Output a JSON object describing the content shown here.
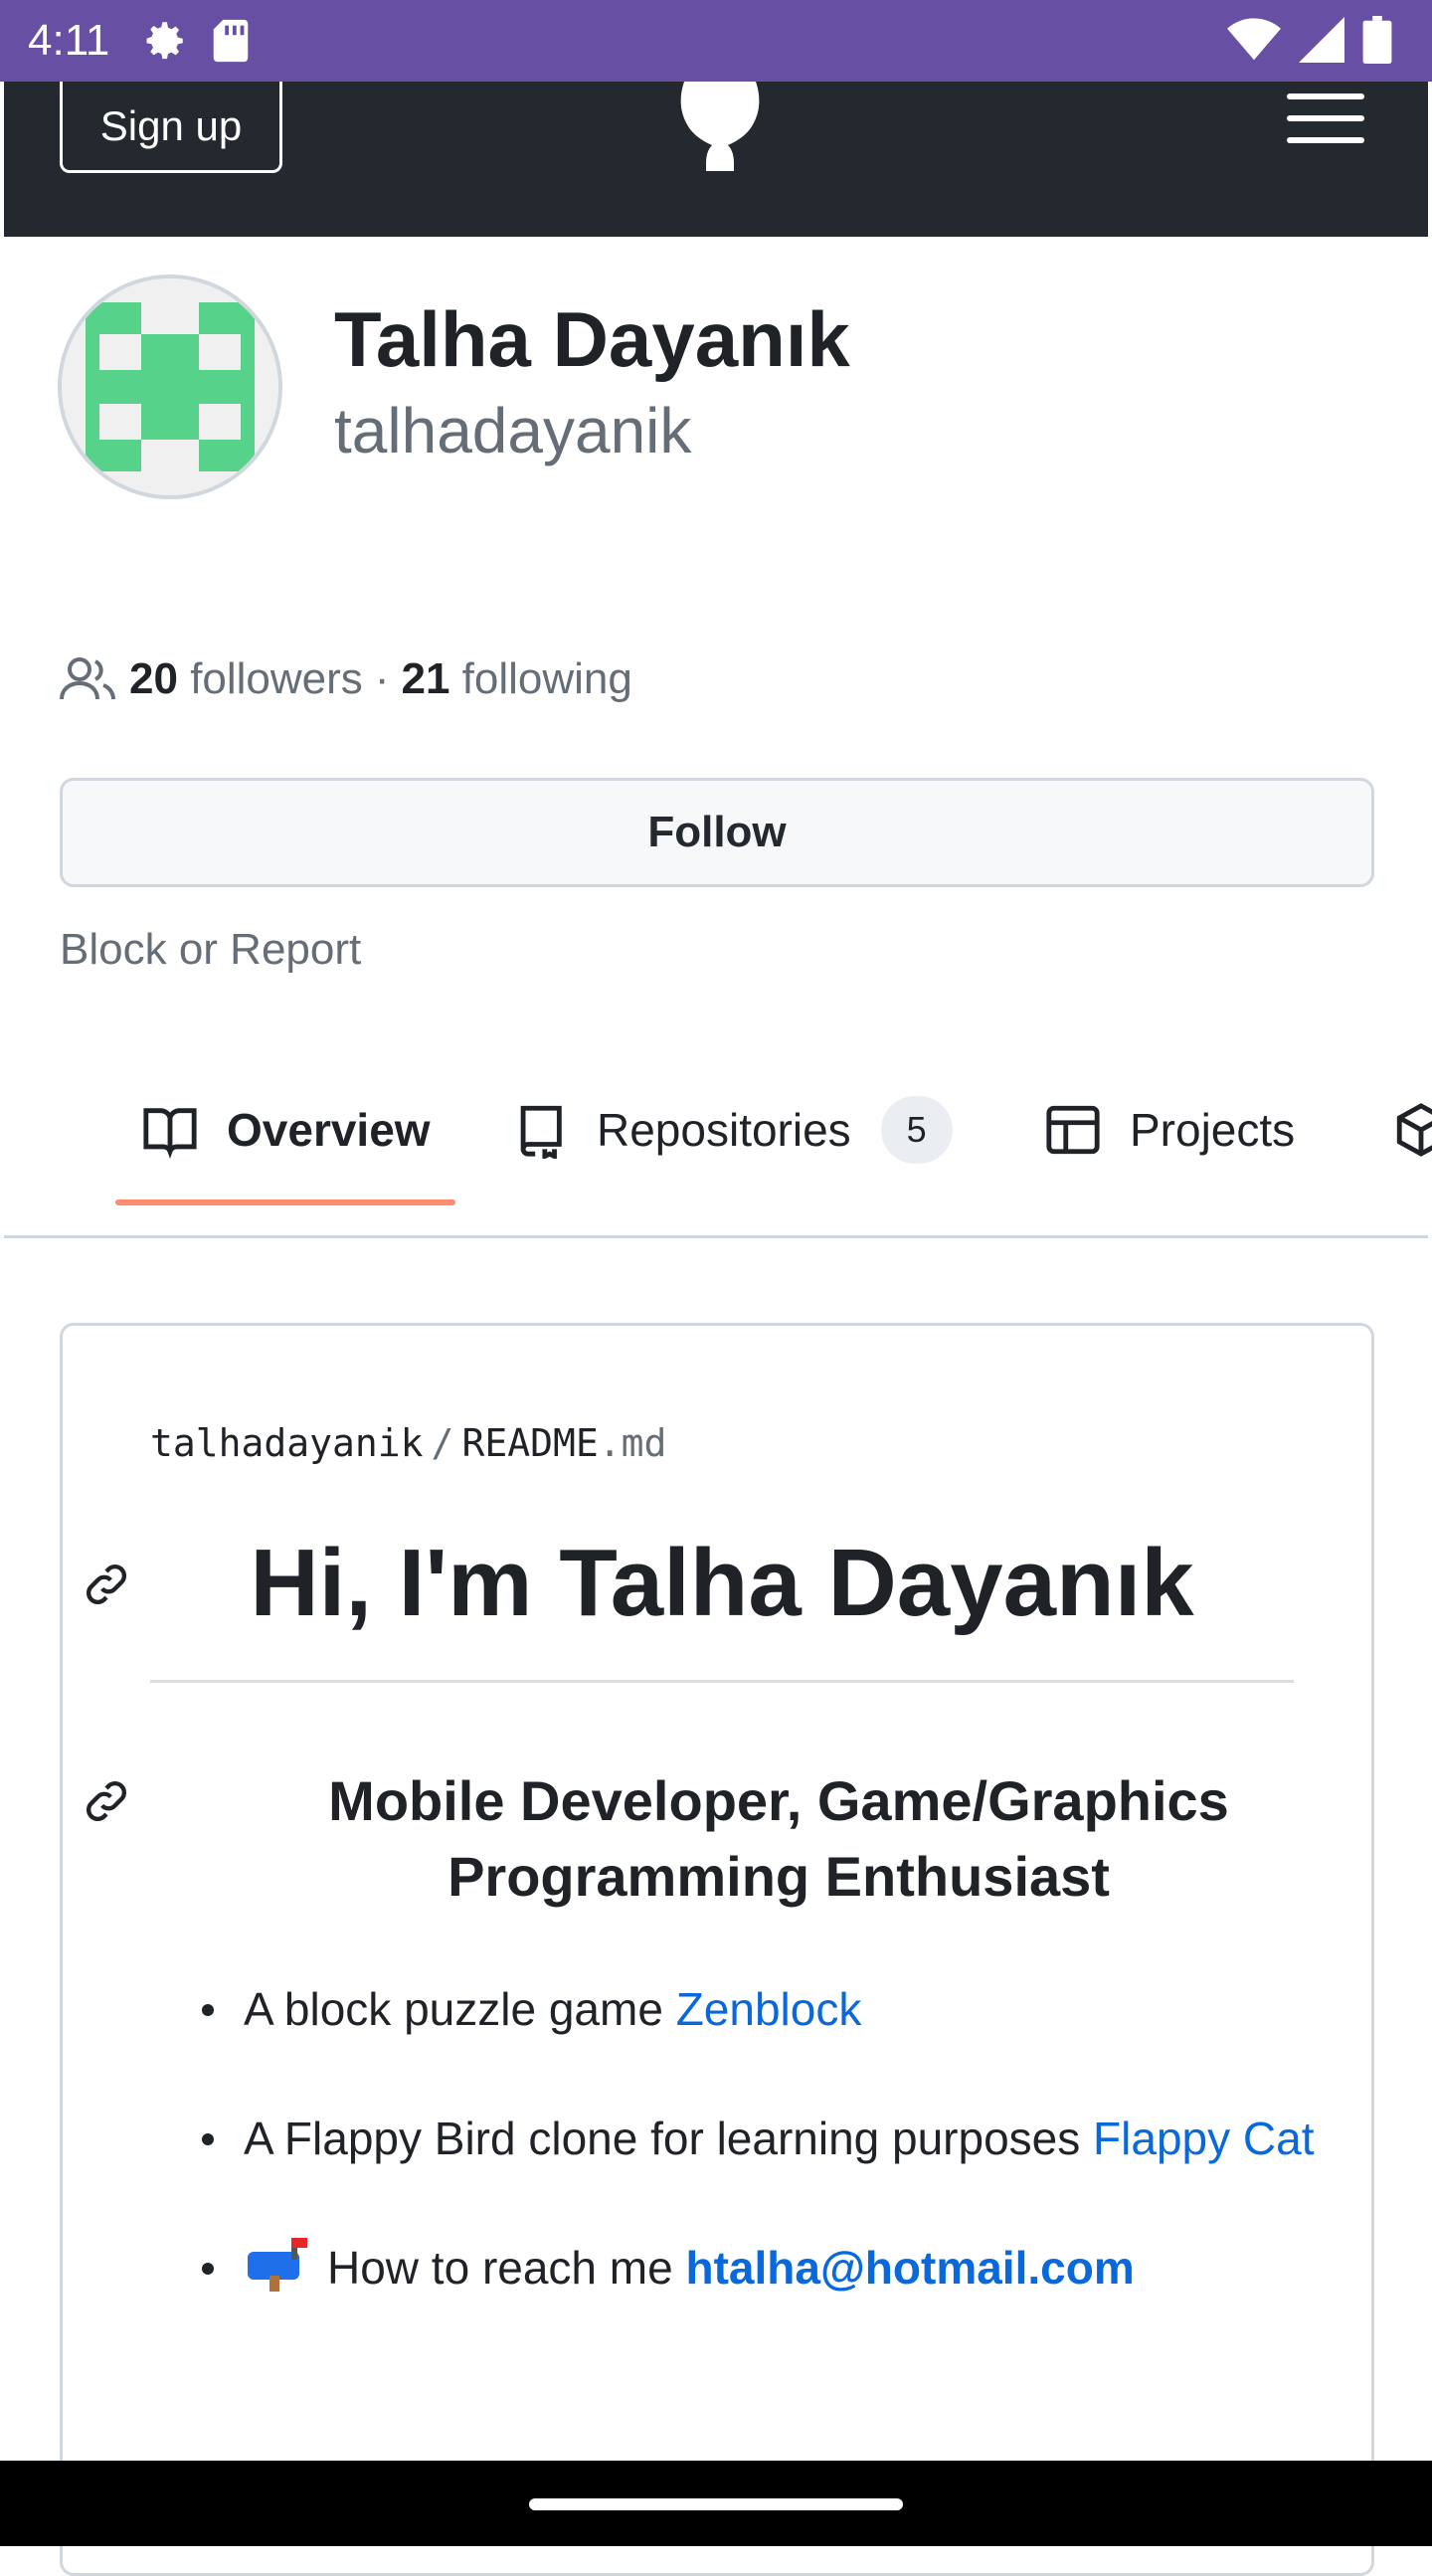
{
  "status_bar": {
    "time": "4:11"
  },
  "header": {
    "signup_label": "Sign up"
  },
  "profile": {
    "name": "Talha Dayanık",
    "login": "talhadayanik",
    "followers_count": "20",
    "followers_label": "followers",
    "separator": "·",
    "following_count": "21",
    "following_label": "following",
    "follow_label": "Follow",
    "block_report_label": "Block or Report"
  },
  "tabs": {
    "overview": "Overview",
    "repositories": "Repositories",
    "repositories_count": "5",
    "projects": "Projects"
  },
  "readme": {
    "path_owner": "talhadayanik",
    "path_sep": "/",
    "path_file": "README",
    "path_ext": ".md",
    "h1": "Hi, I'm Talha Dayanık",
    "h2": "Mobile Developer, Game/Graphics Programming Enthusiast",
    "items": [
      {
        "text": "A block puzzle game ",
        "link": "Zenblock"
      },
      {
        "text": "A Flappy Bird clone for learning purposes ",
        "link": "Flappy Cat"
      },
      {
        "text": "How to reach me ",
        "link": "htalha@hotmail.com"
      }
    ]
  },
  "colors": {
    "status_bar": "#6750a4",
    "header": "#24292f",
    "link": "#0969da",
    "tab_underline": "#fd8c73",
    "avatar_green": "#57d28a"
  }
}
